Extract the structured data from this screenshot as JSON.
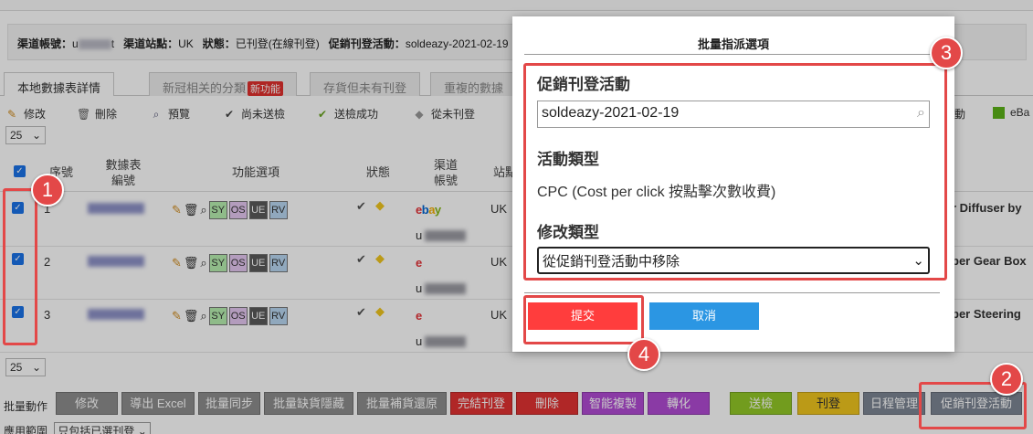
{
  "channel_info": {
    "account_label": "渠道帳號：",
    "account_value_prefix": "u",
    "account_value_suffix": "t",
    "site_label": "渠道站點：",
    "site_value": "UK",
    "status_label": "狀態：",
    "status_value": "已刊登(在線刊登)",
    "promo_label": "促銷刊登活動：",
    "promo_value": "soldeazy-2021-02-19"
  },
  "tabs": [
    {
      "label": "本地數據表詳情",
      "active": true
    },
    {
      "label": "新冠相关的分類",
      "badge": "新功能"
    },
    {
      "label": "存貨但未有刊登"
    },
    {
      "label": "重複的數據"
    }
  ],
  "toolbar": {
    "edit": "修改",
    "delete": "刪除",
    "preview": "預覽",
    "not_checked": "尚未送檢",
    "check_ok": "送檢成功",
    "never_listed": "從未刊登",
    "right_partial": "動",
    "ebay_partial": "eBa"
  },
  "page_size": "25",
  "table_header": {
    "seq": "序號",
    "datasheet_no": "數據表\n編號",
    "functions": "功能選項",
    "status": "狀態",
    "channel_account": "渠道\n帳號",
    "site": "站點"
  },
  "rows": [
    {
      "seq": "1",
      "site": "UK",
      "account_prefix": "u",
      "name": "r Diffuser by"
    },
    {
      "seq": "2",
      "site": "UK",
      "account_prefix": "u",
      "name": "ber Gear Box"
    },
    {
      "seq": "3",
      "site": "UK",
      "account_prefix": "u",
      "name": "ber Steering"
    }
  ],
  "function_buttons": [
    "SY",
    "OS",
    "UE",
    "RV"
  ],
  "bulk_actions": {
    "label": "批量動作",
    "scope_label": "應用範圍",
    "scope_value": "只包括已選刊登",
    "buttons": {
      "edit": "修改",
      "export_excel": "導出 Excel",
      "bulk_sync": "批量同步",
      "bulk_hide_oos": "批量缺貨隱藏",
      "bulk_restock": "批量補貨還原",
      "end_listing": "完結刊登",
      "delete": "刪除",
      "smart_copy": "智能複製",
      "convert": "轉化",
      "send_check": "送檢",
      "list": "刊登",
      "schedule": "日程管理",
      "promo": "促銷刊登活動"
    }
  },
  "modal": {
    "title": "批量指派選項",
    "promo_label": "促銷刊登活動",
    "promo_value": "soldeazy-2021-02-19",
    "type_label": "活動類型",
    "type_value": "CPC (Cost per click 按點擊次數收費)",
    "modify_label": "修改類型",
    "modify_value": "從促銷刊登活動中移除",
    "submit": "提交",
    "cancel": "取消"
  },
  "annotations": [
    "1",
    "2",
    "3",
    "4"
  ],
  "colors": {
    "marker": "#e34848",
    "submit": "#ff3d3d",
    "cancel": "#2b96e3"
  }
}
